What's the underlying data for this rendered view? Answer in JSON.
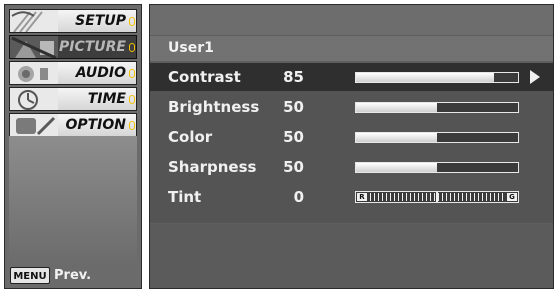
{
  "left_menu": {
    "items": [
      {
        "id": "setup",
        "label": "SETUP",
        "thumb": "setup-thumbnail"
      },
      {
        "id": "picture",
        "label": "PICTURE",
        "thumb": "picture-thumbnail"
      },
      {
        "id": "audio",
        "label": "AUDIO",
        "thumb": "audio-thumbnail"
      },
      {
        "id": "time",
        "label": "TIME",
        "thumb": "time-thumbnail"
      },
      {
        "id": "option",
        "label": "OPTION",
        "thumb": "option-thumbnail"
      }
    ],
    "active_item_id": "picture",
    "prev": {
      "key_label": "MENU",
      "label": "Prev."
    }
  },
  "picture_panel": {
    "title": "User1",
    "rows": [
      {
        "id": "contrast",
        "label": "Contrast",
        "value": "85",
        "level": 0.85,
        "selected": true
      },
      {
        "id": "brightness",
        "label": "Brightness",
        "value": "50",
        "level": 0.5,
        "selected": false
      },
      {
        "id": "color",
        "label": "Color",
        "value": "50",
        "level": 0.5,
        "selected": false
      },
      {
        "id": "sharpness",
        "label": "Sharpness",
        "value": "50",
        "level": 0.5,
        "selected": false
      },
      {
        "id": "tint",
        "label": "Tint",
        "value": "0",
        "level": 0.5,
        "selected": false,
        "type": "tint",
        "left_cap": "R",
        "right_cap": "G"
      }
    ]
  },
  "colors": {
    "accent_mark": "#f2c200",
    "panel_bg": "#5e5e5e",
    "selected_row": "#2f2f2f"
  }
}
